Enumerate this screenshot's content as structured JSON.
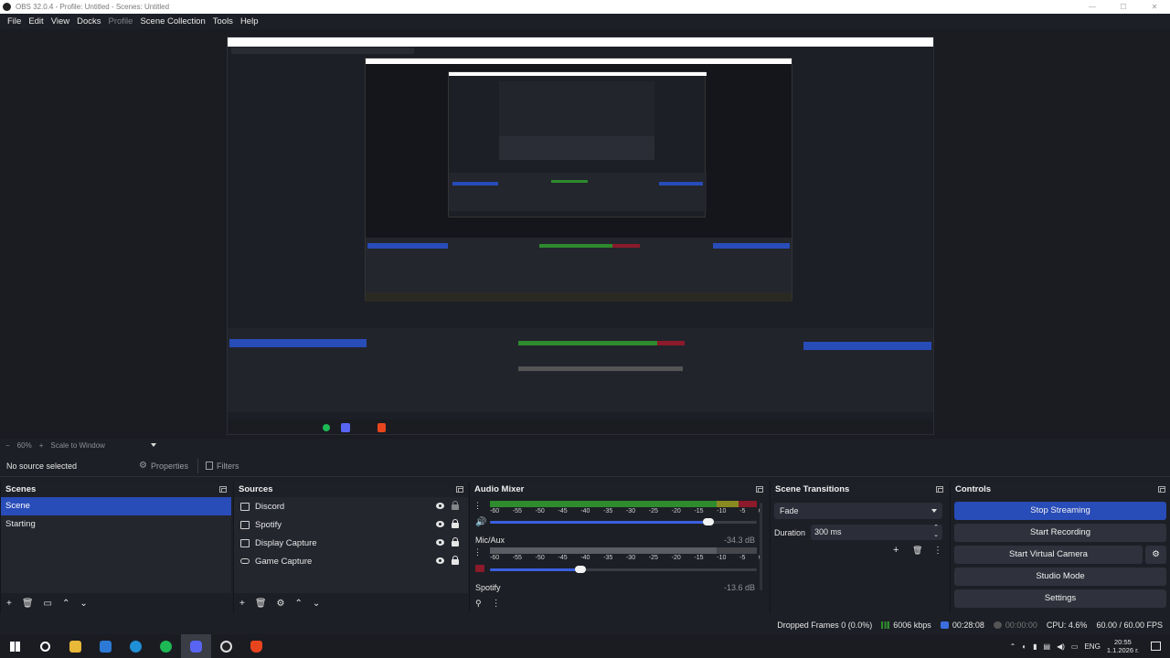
{
  "window": {
    "title": "OBS 32.0.4 - Profile: Untitled - Scenes: Untitled"
  },
  "menu": {
    "items": [
      "File",
      "Edit",
      "View",
      "Docks",
      "Profile",
      "Scene Collection",
      "Tools",
      "Help"
    ]
  },
  "zoom": {
    "minus": "−",
    "value": "60%",
    "plus": "+",
    "mode": "Scale to Window"
  },
  "context": {
    "no_source": "No source selected",
    "properties": "Properties",
    "filters": "Filters"
  },
  "scenes": {
    "title": "Scenes",
    "items": [
      {
        "label": "Scene",
        "selected": true
      },
      {
        "label": "Starting",
        "selected": false
      }
    ]
  },
  "sources": {
    "title": "Sources",
    "items": [
      {
        "label": "Discord",
        "icon": "window-capture-icon"
      },
      {
        "label": "Spotify",
        "icon": "window-capture-icon"
      },
      {
        "label": "Display Capture",
        "icon": "display-capture-icon"
      },
      {
        "label": "Game Capture",
        "icon": "game-capture-icon"
      }
    ]
  },
  "audio_mixer": {
    "title": "Audio Mixer",
    "ticks": [
      "-60",
      "-55",
      "-50",
      "-45",
      "-40",
      "-35",
      "-30",
      "-25",
      "-20",
      "-15",
      "-10",
      "-5",
      "0"
    ],
    "channels": [
      {
        "name": "",
        "db": "",
        "volume": 0.82
      },
      {
        "name": "Mic/Aux",
        "db": "-34.3 dB",
        "volume": 0.34
      },
      {
        "name": "Spotify",
        "db": "-13.6 dB",
        "volume": null
      }
    ]
  },
  "scene_transitions": {
    "title": "Scene Transitions",
    "transition": "Fade",
    "duration_label": "Duration",
    "duration_value": "300 ms"
  },
  "controls": {
    "title": "Controls",
    "stop_streaming": "Stop Streaming",
    "start_recording": "Start Recording",
    "start_virtual_camera": "Start Virtual Camera",
    "studio_mode": "Studio Mode",
    "settings": "Settings"
  },
  "status": {
    "dropped_frames": "Dropped Frames 0 (0.0%)",
    "bitrate": "6006 kbps",
    "stream_time": "00:28:08",
    "rec_time": "00:00:00",
    "cpu": "CPU: 4.6%",
    "fps": "60.00 / 60.00 FPS"
  },
  "taskbar": {
    "lang": "ENG",
    "time": "20:55",
    "date": "1.1.2026 г."
  },
  "colors": {
    "accent": "#284cb8",
    "meter_green": "#2e8b2e",
    "meter_yellow": "#8a8a22",
    "meter_red": "#8b1a2a",
    "slider_blue": "#3b5fe0"
  }
}
